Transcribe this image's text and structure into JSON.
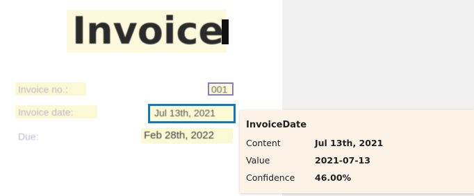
{
  "document": {
    "title": "Invoice",
    "fields": [
      {
        "label": "Invoice no.:",
        "value": "001"
      },
      {
        "label": "Invoice date:",
        "value": "Jul 13th, 2021"
      },
      {
        "label": "Due:",
        "value": "Feb 28th, 2022"
      }
    ]
  },
  "tooltip": {
    "field_name": "InvoiceDate",
    "rows": [
      {
        "key": "Content",
        "value": "Jul 13th, 2021"
      },
      {
        "key": "Value",
        "value": "2021-07-13"
      },
      {
        "key": "Confidence",
        "value": "46.00%"
      }
    ]
  },
  "colors": {
    "field_highlight": "#fbf8d4",
    "selected_field_border": "#0f78c6",
    "field_box_border": "#8a78c8",
    "tooltip_background": "#fdf2e6"
  }
}
